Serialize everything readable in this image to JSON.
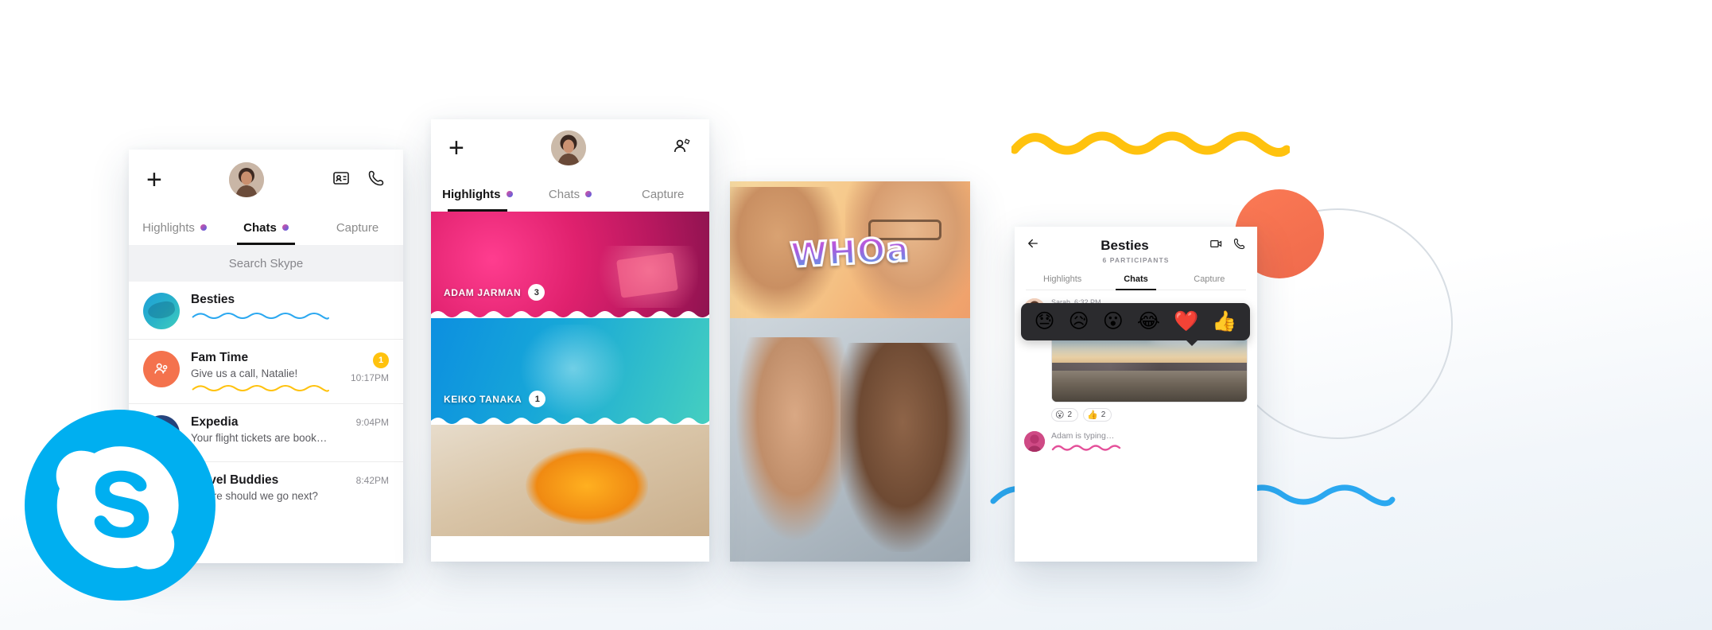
{
  "brand": {
    "name": "Skype",
    "logo_icon": "skype-logo-icon",
    "accent_blue": "#00AFF0",
    "accent_yellow": "#FFC20E",
    "accent_orange": "#F4724D",
    "accent_pink": "#E4509A"
  },
  "phone_chat_list": {
    "topbar": {
      "new_chat_icon": "plus-icon",
      "profile_avatar": "user-avatar",
      "contacts_icon": "contact-card-icon",
      "calls_icon": "phone-icon"
    },
    "tabs": [
      {
        "label": "Highlights",
        "active": false,
        "has_dot": true
      },
      {
        "label": "Chats",
        "active": true,
        "has_dot": true
      },
      {
        "label": "Capture",
        "active": false,
        "has_dot": false
      }
    ],
    "search": {
      "placeholder": "Search Skype"
    },
    "rows": [
      {
        "name": "Besties",
        "message": "",
        "time": "",
        "badge": "",
        "avatar": "fish-avatar",
        "squiggle": "blue"
      },
      {
        "name": "Fam Time",
        "message": "Give us a call, Natalie!",
        "time": "10:17PM",
        "badge": "1",
        "avatar": "group-avatar",
        "squiggle": "yellow"
      },
      {
        "name": "Expedia",
        "message": "Your flight tickets are booked.",
        "time": "9:04PM",
        "badge": "",
        "avatar": "expedia-avatar",
        "squiggle": ""
      },
      {
        "name": "Travel Buddies",
        "message": "Where should we go next?",
        "time": "8:42PM",
        "badge": "",
        "avatar": "travel-avatar",
        "squiggle": ""
      }
    ]
  },
  "phone_highlights": {
    "topbar": {
      "new_chat_icon": "plus-icon",
      "profile_avatar": "user-avatar",
      "add_contact_icon": "add-person-icon"
    },
    "tabs": [
      {
        "label": "Highlights",
        "active": true,
        "has_dot": true
      },
      {
        "label": "Chats",
        "active": false,
        "has_dot": true
      },
      {
        "label": "Capture",
        "active": false,
        "has_dot": false
      }
    ],
    "cards": [
      {
        "name": "ADAM JARMAN",
        "badge": "3",
        "theme": "concert-pink"
      },
      {
        "name": "KEIKO TANAKA",
        "badge": "1",
        "theme": "child-blue"
      },
      {
        "name": "",
        "badge": "",
        "theme": "goldfish-warm"
      }
    ]
  },
  "phone_capture": {
    "sticker_text": "WHOa",
    "top_scene": "two-people-laughing",
    "bottom_scene": "two-friends-smiling"
  },
  "phone_conversation": {
    "header": {
      "back_icon": "arrow-left-icon",
      "title": "Besties",
      "subtitle": "6 PARTICIPANTS",
      "video_call_icon": "video-camera-icon",
      "audio_call_icon": "phone-icon"
    },
    "tabs": [
      {
        "label": "Highlights",
        "active": false
      },
      {
        "label": "Chats",
        "active": true
      },
      {
        "label": "Capture",
        "active": false
      }
    ],
    "reaction_picker": {
      "emojis": [
        "😓",
        "😥",
        "😮",
        "😂",
        "❤️",
        "👍"
      ],
      "names": [
        "sweat-face-emoji",
        "crying-face-emoji",
        "surprised-face-emoji",
        "laughing-tears-emoji",
        "heart-emoji",
        "thumbs-up-emoji"
      ]
    },
    "message": {
      "sender_meta": "Sarah, 6:32 PM",
      "attachment": "city-skyline-sunset-photo",
      "react_button_icon": "add-reaction-icon"
    },
    "reaction_chips": [
      {
        "emoji": "😮",
        "count": "2",
        "name": "surprised-face-reaction"
      },
      {
        "emoji": "👍",
        "count": "2",
        "name": "thumbs-up-reaction"
      }
    ],
    "typing": {
      "text": "Adam is typing…",
      "avatar": "adam-avatar",
      "squiggle": "pink"
    }
  },
  "decorations": {
    "yellow_wave": "yellow-squiggle-decoration",
    "blue_wave": "blue-squiggle-decoration",
    "orange_circle": "orange-circle-decoration",
    "outline_circle": "outline-circle-decoration"
  }
}
